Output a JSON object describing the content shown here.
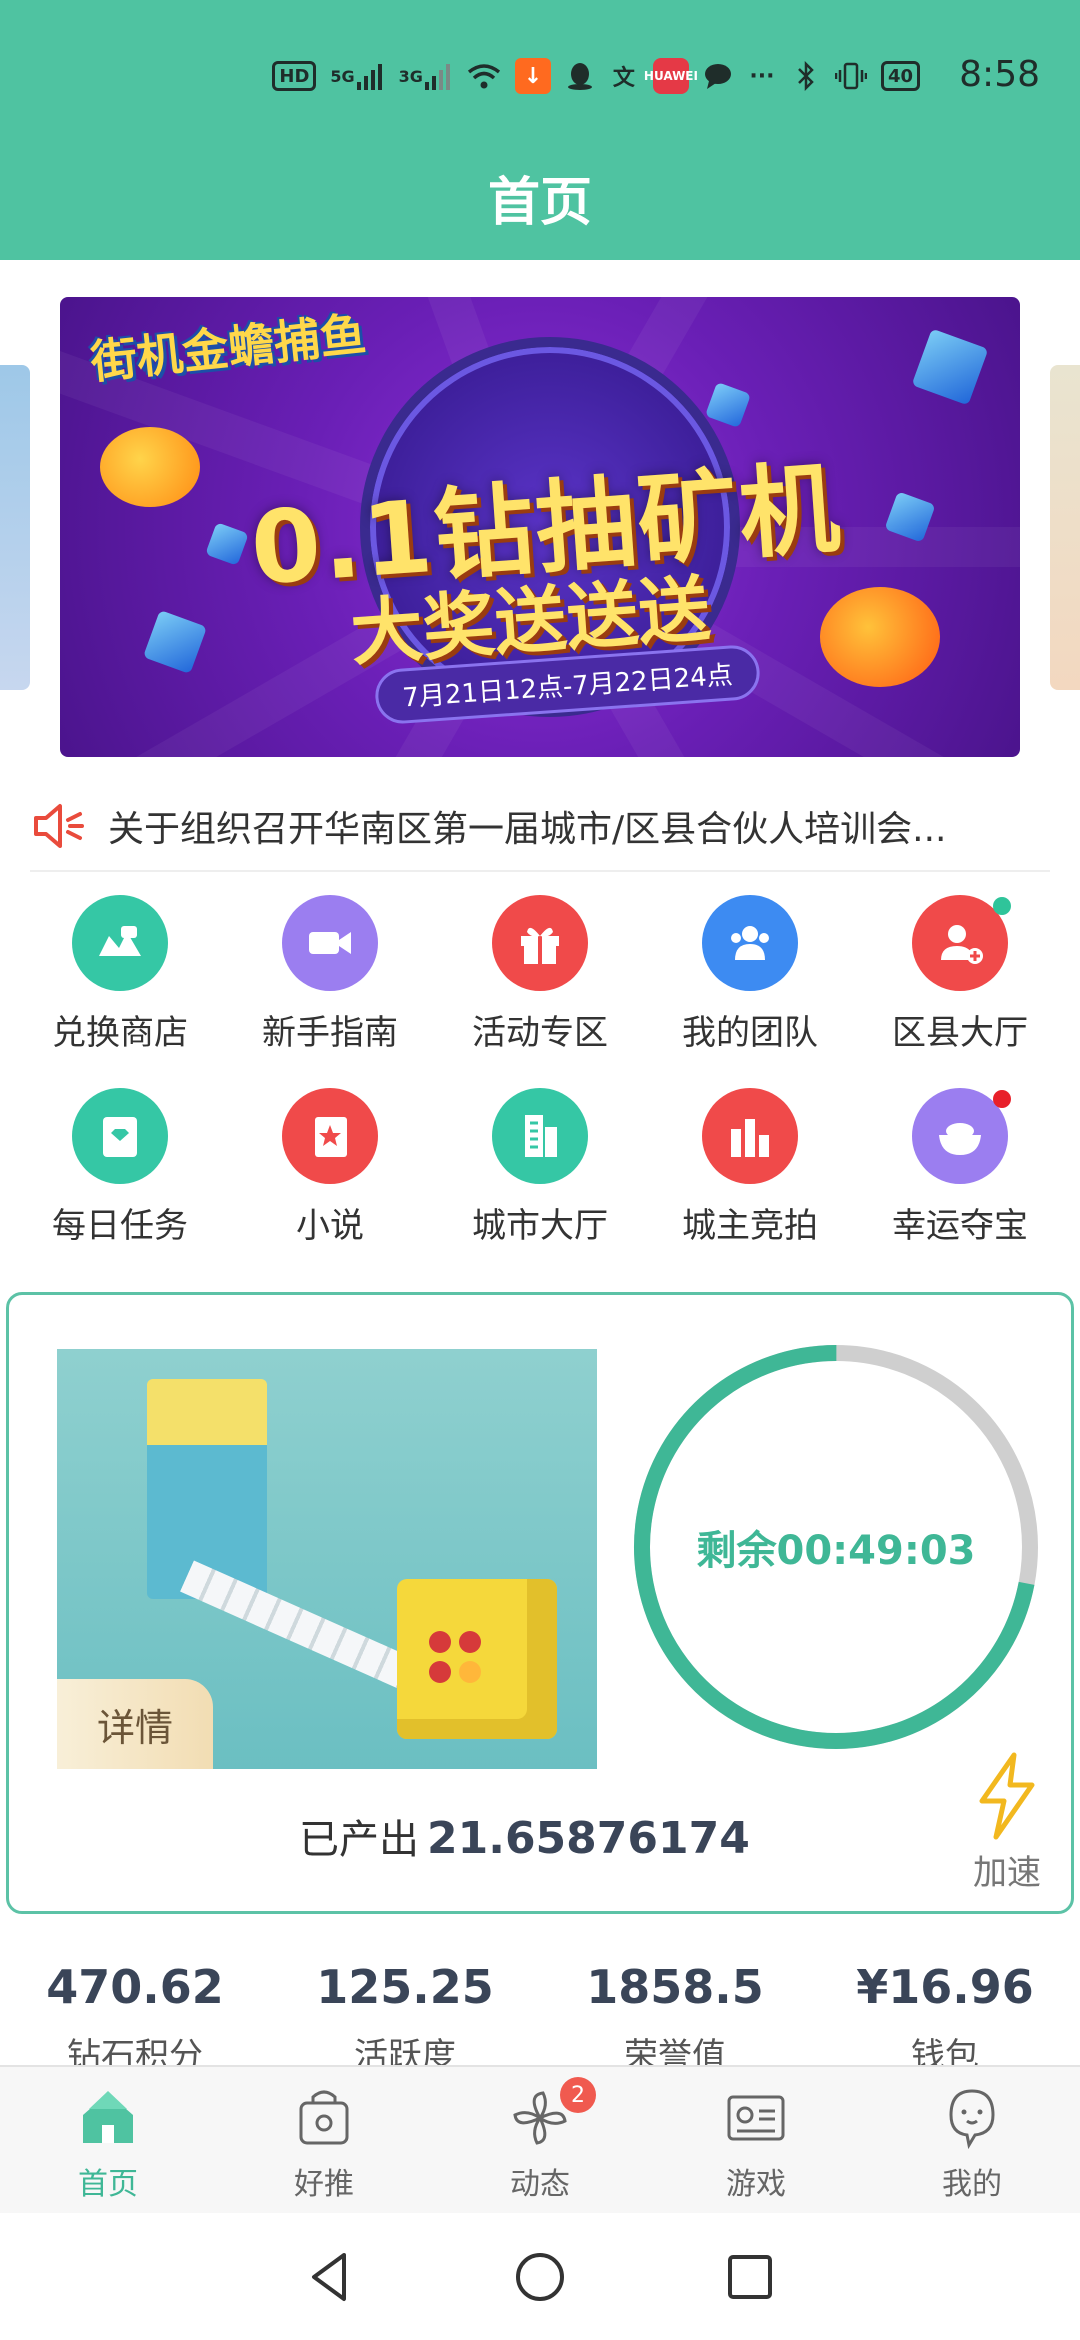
{
  "status_bar": {
    "time": "8:58",
    "icons": [
      "hd-icon",
      "signal-5g-icon",
      "signal-3g-icon",
      "wifi-icon",
      "download-icon",
      "qq-icon",
      "translate-icon",
      "huawei-app-icon",
      "chat-icon",
      "more-icon",
      "bluetooth-icon",
      "vibrate-icon",
      "battery-icon"
    ],
    "hd_label": "HD",
    "net1": "5G",
    "net2": "3G",
    "battery": "40",
    "huawei": "HUAWEI",
    "more": "···"
  },
  "header": {
    "title": "首页"
  },
  "banner": {
    "logo": "街机金蟾捕鱼",
    "headline": "0.1钻抽矿机",
    "subline": "大奖送送送",
    "date": "7月21日12点-7月22日24点"
  },
  "notice": {
    "text": "关于组织召开华南区第一届城市/区县合伙人培训会..."
  },
  "grid": [
    {
      "label": "兑换商店",
      "color": "#35c7a5",
      "icon": "shop-icon"
    },
    {
      "label": "新手指南",
      "color": "#9b7ef0",
      "icon": "video-icon"
    },
    {
      "label": "活动专区",
      "color": "#f04a4a",
      "icon": "gift-icon"
    },
    {
      "label": "我的团队",
      "color": "#3d8bf2",
      "icon": "team-icon"
    },
    {
      "label": "区县大厅",
      "color": "#f04a4a",
      "icon": "add-user-icon",
      "dot": "#2fc49a"
    },
    {
      "label": "每日任务",
      "color": "#35c7a5",
      "icon": "task-icon"
    },
    {
      "label": "小说",
      "color": "#f04a4a",
      "icon": "book-icon"
    },
    {
      "label": "城市大厅",
      "color": "#35c7a5",
      "icon": "building-icon"
    },
    {
      "label": "城主竞拍",
      "color": "#f04a4a",
      "icon": "auction-icon"
    },
    {
      "label": "幸运夺宝",
      "color": "#9b7ef0",
      "icon": "treasure-icon",
      "dot": "#e8202a"
    }
  ],
  "mining": {
    "details_label": "详情",
    "remaining": "剩余00:49:03",
    "remaining_fraction": 0.72,
    "produced_label": "已产出",
    "produced_value": "21.65876174",
    "speed_label": "加速"
  },
  "stats": [
    {
      "value": "470.62",
      "label": "钻石积分"
    },
    {
      "value": "125.25",
      "label": "活跃度"
    },
    {
      "value": "1858.5",
      "label": "荣誉值"
    },
    {
      "value": "¥16.96",
      "label": "钱包"
    }
  ],
  "tabs": [
    {
      "label": "首页",
      "active": true
    },
    {
      "label": "好推",
      "active": false
    },
    {
      "label": "动态",
      "active": false,
      "badge": "2"
    },
    {
      "label": "游戏",
      "active": false
    },
    {
      "label": "我的",
      "active": false
    }
  ],
  "colors": {
    "primary": "#4fc3a1",
    "accent": "#3fb796",
    "ring_track": "#cccccc"
  }
}
